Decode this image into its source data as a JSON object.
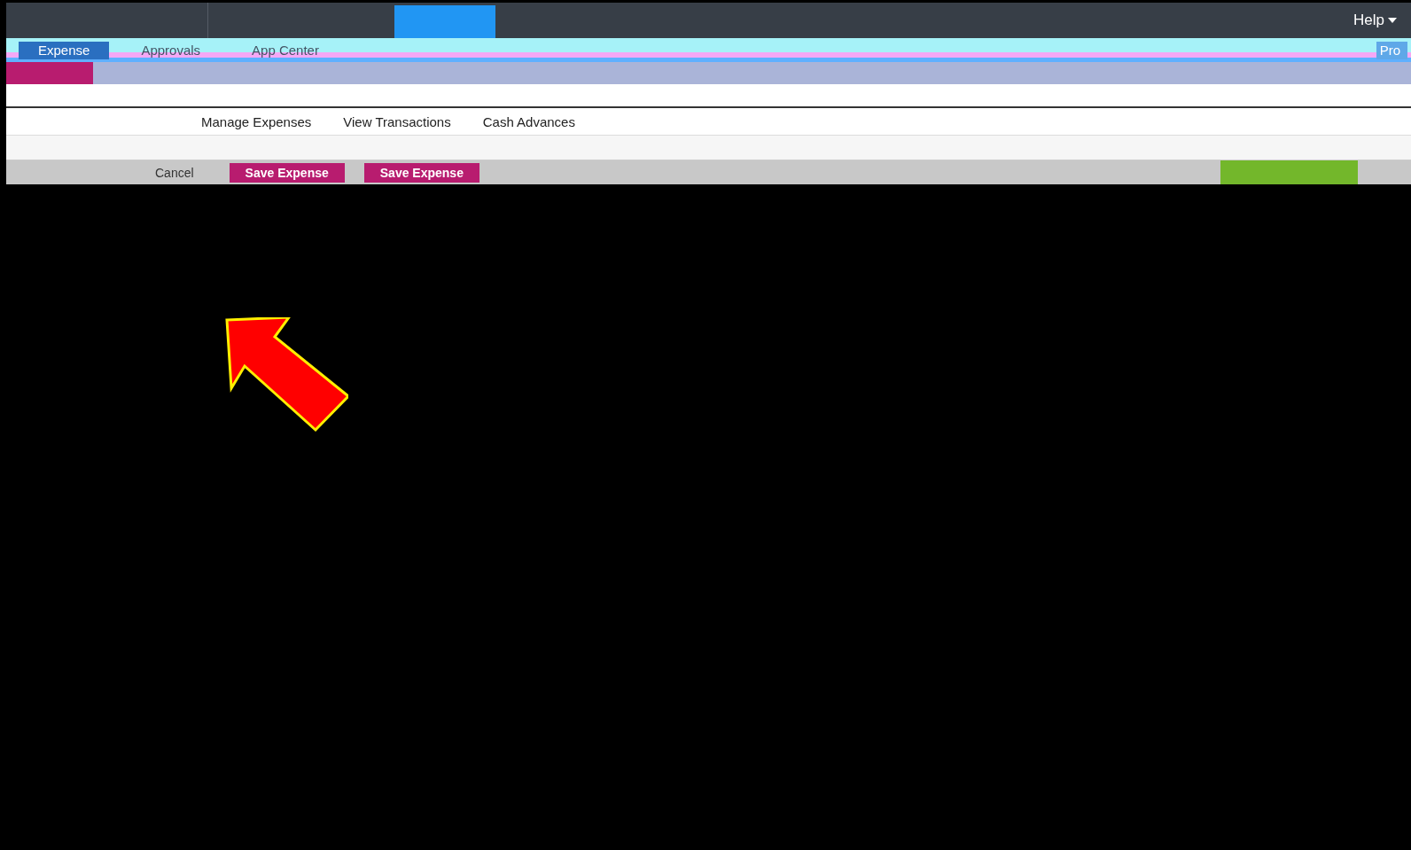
{
  "top_bar": {
    "help_menu": "Help"
  },
  "module_tabs": [
    {
      "label": "Expense",
      "selected": true
    },
    {
      "label": "Approvals",
      "selected": false
    },
    {
      "label": "App Center",
      "selected": false
    }
  ],
  "profile": "Pro",
  "sub_nav": [
    "Manage Expenses",
    "View Transactions",
    "Cash Advances"
  ],
  "toolbar": {
    "buttons": [
      {
        "label": "Cancel",
        "kind": "plain"
      },
      {
        "label": "Save Expense",
        "kind": "primary"
      },
      {
        "label": "Save Expense",
        "kind": "primary"
      }
    ]
  }
}
